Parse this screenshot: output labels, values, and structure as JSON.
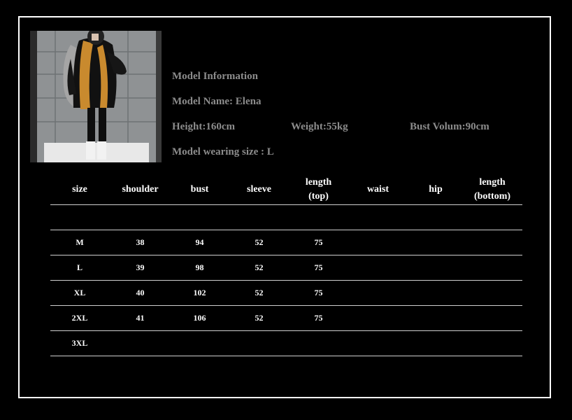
{
  "model_info": {
    "title": "Model Information",
    "name": "Model Name: Elena",
    "height": "Height:160cm",
    "weight": "Weight:55kg",
    "bust": "Bust Volum:90cm",
    "wearing_size": "Model wearing size : L"
  },
  "size_table": {
    "headers": [
      {
        "line1": "size",
        "line2": ""
      },
      {
        "line1": "shoulder",
        "line2": ""
      },
      {
        "line1": "bust",
        "line2": ""
      },
      {
        "line1": "sleeve",
        "line2": ""
      },
      {
        "line1": "length",
        "line2": "(top)"
      },
      {
        "line1": "waist",
        "line2": ""
      },
      {
        "line1": "hip",
        "line2": ""
      },
      {
        "line1": "length",
        "line2": "(bottom)"
      }
    ],
    "rows": [
      [
        "M",
        "38",
        "94",
        "52",
        "75",
        "",
        "",
        ""
      ],
      [
        "L",
        "39",
        "98",
        "52",
        "75",
        "",
        "",
        ""
      ],
      [
        "XL",
        "40",
        "102",
        "52",
        "75",
        "",
        "",
        ""
      ],
      [
        "2XL",
        "41",
        "106",
        "52",
        "75",
        "",
        "",
        ""
      ],
      [
        "3XL",
        "",
        "",
        "",
        "",
        "",
        "",
        ""
      ]
    ]
  },
  "colors": {
    "background": "#000000",
    "frame": "#ffffff",
    "info_text": "#8c8c8c",
    "table_text": "#ffffff",
    "fur_accent": "#c98a2e"
  }
}
